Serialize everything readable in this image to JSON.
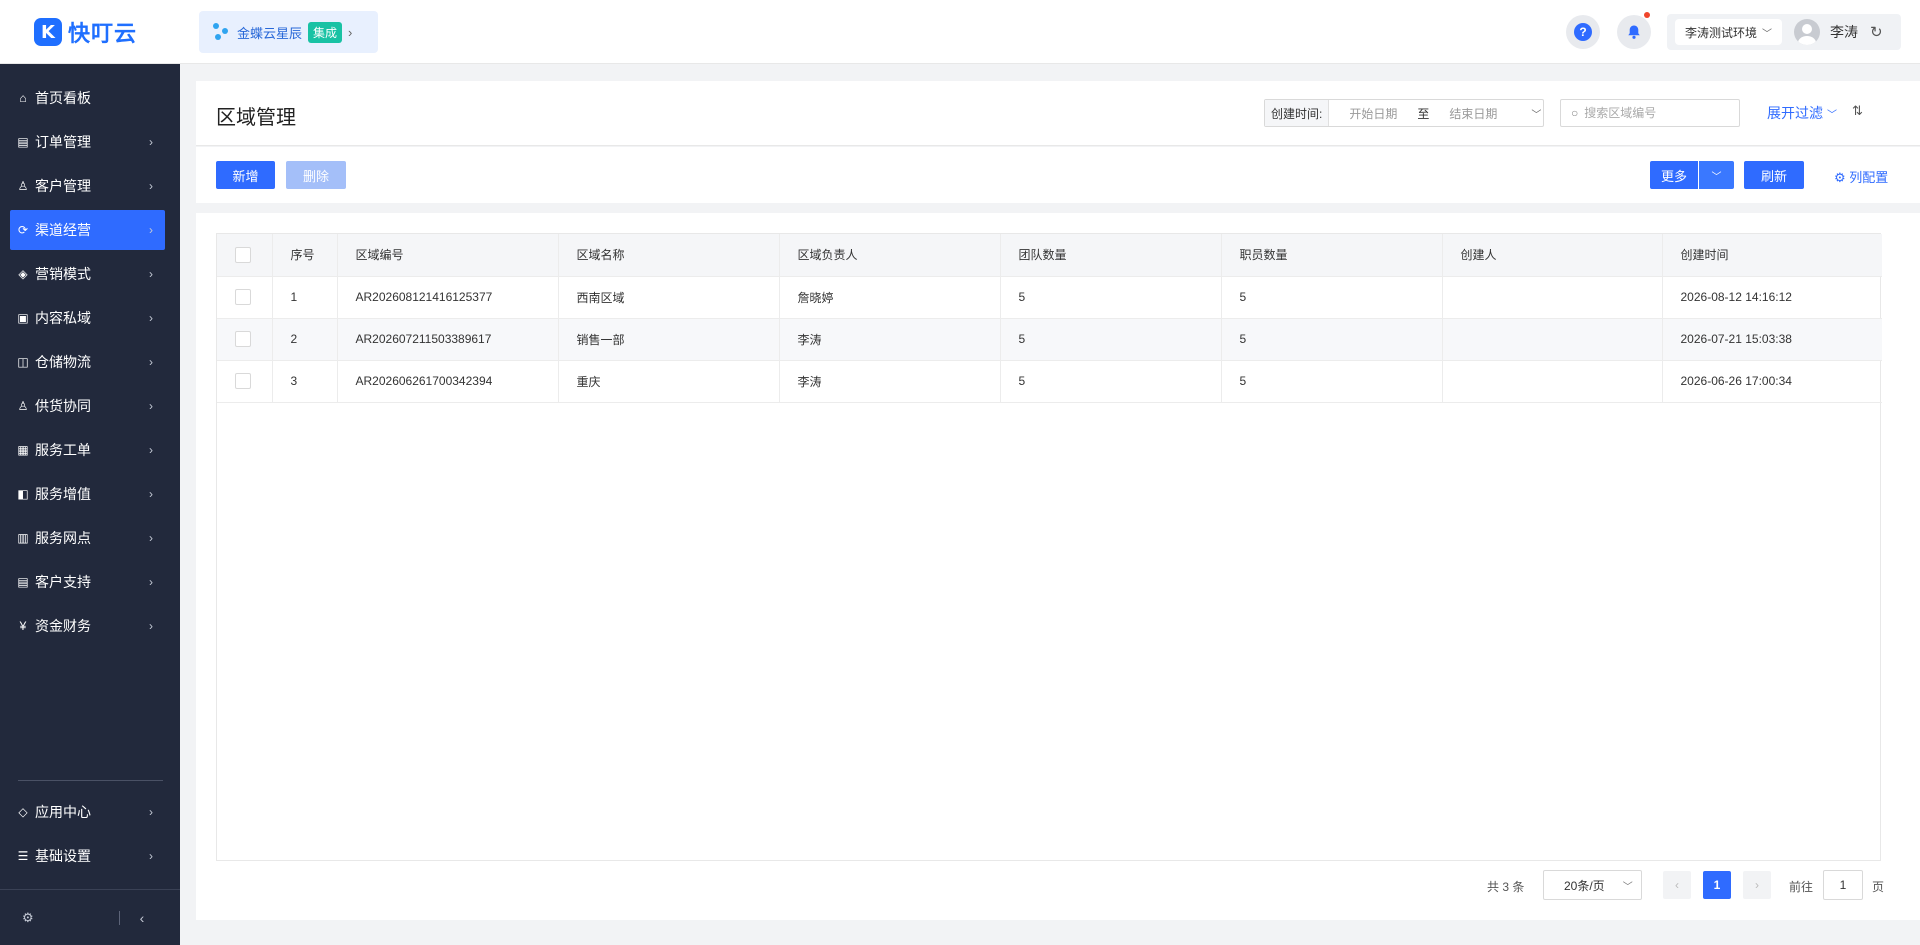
{
  "brand": {
    "logo_letter": "K",
    "name": "快叮云"
  },
  "integration": {
    "label": "金蝶云星辰",
    "badge": "集成",
    "arrow": "›"
  },
  "header": {
    "help": "?",
    "env": "李涛测试环境",
    "user_name": "李涛",
    "colors": {
      "accent": "#2f6bff",
      "notify_dot": "#f0452b",
      "badge": "#19c2a4"
    }
  },
  "sidebar": {
    "items": [
      {
        "label": "首页看板",
        "icon": "home-icon",
        "glyph": "⌂",
        "has_arrow": false
      },
      {
        "label": "订单管理",
        "icon": "clipboard-icon",
        "glyph": "▤",
        "has_arrow": true
      },
      {
        "label": "客户管理",
        "icon": "user-icon",
        "glyph": "♙",
        "has_arrow": true
      },
      {
        "label": "渠道经营",
        "icon": "channel-icon",
        "glyph": "⟳",
        "has_arrow": true,
        "active": true
      },
      {
        "label": "营销模式",
        "icon": "tag-icon",
        "glyph": "◈",
        "has_arrow": true
      },
      {
        "label": "内容私域",
        "icon": "image-icon",
        "glyph": "▣",
        "has_arrow": true
      },
      {
        "label": "仓储物流",
        "icon": "warehouse-icon",
        "glyph": "◫",
        "has_arrow": true
      },
      {
        "label": "供货协同",
        "icon": "supplier-icon",
        "glyph": "♙",
        "has_arrow": true
      },
      {
        "label": "服务工单",
        "icon": "ticket-icon",
        "glyph": "▦",
        "has_arrow": true
      },
      {
        "label": "服务增值",
        "icon": "bag-icon",
        "glyph": "◧",
        "has_arrow": true
      },
      {
        "label": "服务网点",
        "icon": "store-icon",
        "glyph": "▥",
        "has_arrow": true
      },
      {
        "label": "客户支持",
        "icon": "support-icon",
        "glyph": "▤",
        "has_arrow": true
      },
      {
        "label": "资金财务",
        "icon": "yen-icon",
        "glyph": "¥",
        "has_arrow": true
      }
    ],
    "bottom_items": [
      {
        "label": "应用中心",
        "icon": "cube-icon",
        "glyph": "◇",
        "has_arrow": true
      },
      {
        "label": "基础设置",
        "icon": "settings-list-icon",
        "glyph": "☰",
        "has_arrow": true
      }
    ]
  },
  "page": {
    "title": "区域管理",
    "filter": {
      "created_label": "创建时间:",
      "start_placeholder": "开始日期",
      "separator": "至",
      "end_placeholder": "结束日期",
      "search_placeholder": "搜索区域编号",
      "expand_label": "展开过滤"
    },
    "toolbar": {
      "add": "新增",
      "delete": "删除",
      "more": "更多",
      "refresh": "刷新",
      "column_config": "列配置"
    }
  },
  "table": {
    "columns": [
      "序号",
      "区域编号",
      "区域名称",
      "区域负责人",
      "团队数量",
      "职员数量",
      "创建人",
      "创建时间"
    ],
    "rows": [
      [
        "1",
        "AR202608121416125377",
        "西南区域",
        "詹晓婷",
        "5",
        "5",
        "",
        "2026-08-12 14:16:12"
      ],
      [
        "2",
        "AR202607211503389617",
        "销售一部",
        "李涛",
        "5",
        "5",
        "",
        "2026-07-21 15:03:38"
      ],
      [
        "3",
        "AR202606261700342394",
        "重庆",
        "李涛",
        "5",
        "5",
        "",
        "2026-06-26 17:00:34"
      ]
    ]
  },
  "pagination": {
    "total": "共 3 条",
    "page_size": "20条/页",
    "current_page": "1",
    "goto_label": "前往",
    "goto_value": "1",
    "page_suffix": "页"
  }
}
